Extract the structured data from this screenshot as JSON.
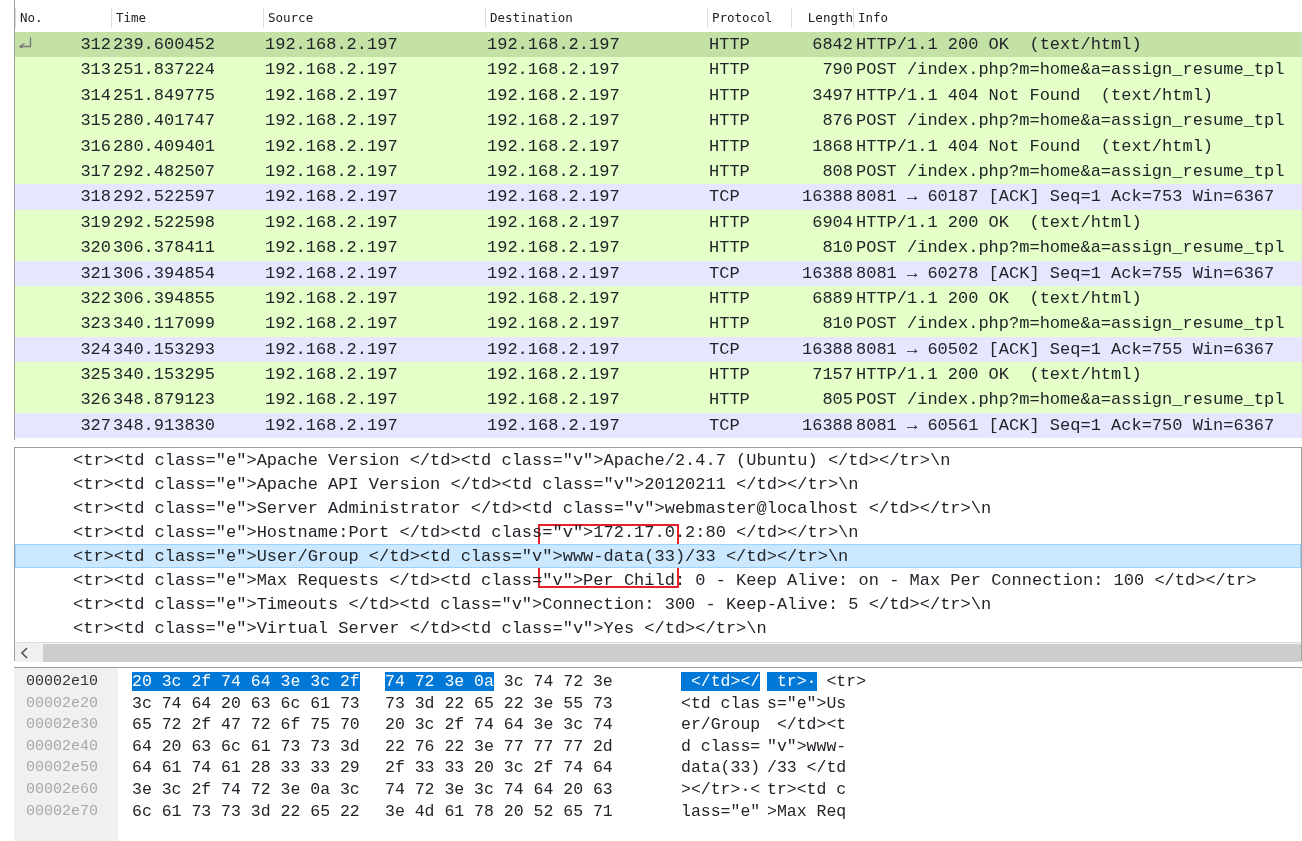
{
  "packet_list": {
    "columns": [
      "No.",
      "Time",
      "Source",
      "Destination",
      "Protocol",
      "Length",
      "Info"
    ],
    "rows": [
      {
        "no": "312",
        "time": "239.600452",
        "source": "192.168.2.197",
        "destination": "192.168.2.197",
        "protocol": "HTTP",
        "length": "6842",
        "info": "HTTP/1.1 200 OK  (text/html)",
        "color": "#e4ffc7",
        "selected": true,
        "related": true
      },
      {
        "no": "313",
        "time": "251.837224",
        "source": "192.168.2.197",
        "destination": "192.168.2.197",
        "protocol": "HTTP",
        "length": "790",
        "info": "POST /index.php?m=home&a=assign_resume_tpl",
        "color": "#e4ffc7",
        "selected": false,
        "related": false
      },
      {
        "no": "314",
        "time": "251.849775",
        "source": "192.168.2.197",
        "destination": "192.168.2.197",
        "protocol": "HTTP",
        "length": "3497",
        "info": "HTTP/1.1 404 Not Found  (text/html)",
        "color": "#e4ffc7",
        "selected": false,
        "related": false
      },
      {
        "no": "315",
        "time": "280.401747",
        "source": "192.168.2.197",
        "destination": "192.168.2.197",
        "protocol": "HTTP",
        "length": "876",
        "info": "POST /index.php?m=home&a=assign_resume_tpl",
        "color": "#e4ffc7",
        "selected": false,
        "related": false
      },
      {
        "no": "316",
        "time": "280.409401",
        "source": "192.168.2.197",
        "destination": "192.168.2.197",
        "protocol": "HTTP",
        "length": "1868",
        "info": "HTTP/1.1 404 Not Found  (text/html)",
        "color": "#e4ffc7",
        "selected": false,
        "related": false
      },
      {
        "no": "317",
        "time": "292.482507",
        "source": "192.168.2.197",
        "destination": "192.168.2.197",
        "protocol": "HTTP",
        "length": "808",
        "info": "POST /index.php?m=home&a=assign_resume_tpl",
        "color": "#e4ffc7",
        "selected": false,
        "related": false
      },
      {
        "no": "318",
        "time": "292.522597",
        "source": "192.168.2.197",
        "destination": "192.168.2.197",
        "protocol": "TCP",
        "length": "16388",
        "info": "8081 → 60187 [ACK] Seq=1 Ack=753 Win=6367",
        "color": "#e7e6ff",
        "selected": false,
        "related": false
      },
      {
        "no": "319",
        "time": "292.522598",
        "source": "192.168.2.197",
        "destination": "192.168.2.197",
        "protocol": "HTTP",
        "length": "6904",
        "info": "HTTP/1.1 200 OK  (text/html)",
        "color": "#e4ffc7",
        "selected": false,
        "related": false
      },
      {
        "no": "320",
        "time": "306.378411",
        "source": "192.168.2.197",
        "destination": "192.168.2.197",
        "protocol": "HTTP",
        "length": "810",
        "info": "POST /index.php?m=home&a=assign_resume_tpl",
        "color": "#e4ffc7",
        "selected": false,
        "related": false
      },
      {
        "no": "321",
        "time": "306.394854",
        "source": "192.168.2.197",
        "destination": "192.168.2.197",
        "protocol": "TCP",
        "length": "16388",
        "info": "8081 → 60278 [ACK] Seq=1 Ack=755 Win=6367",
        "color": "#e7e6ff",
        "selected": false,
        "related": false
      },
      {
        "no": "322",
        "time": "306.394855",
        "source": "192.168.2.197",
        "destination": "192.168.2.197",
        "protocol": "HTTP",
        "length": "6889",
        "info": "HTTP/1.1 200 OK  (text/html)",
        "color": "#e4ffc7",
        "selected": false,
        "related": false
      },
      {
        "no": "323",
        "time": "340.117099",
        "source": "192.168.2.197",
        "destination": "192.168.2.197",
        "protocol": "HTTP",
        "length": "810",
        "info": "POST /index.php?m=home&a=assign_resume_tpl",
        "color": "#e4ffc7",
        "selected": false,
        "related": false
      },
      {
        "no": "324",
        "time": "340.153293",
        "source": "192.168.2.197",
        "destination": "192.168.2.197",
        "protocol": "TCP",
        "length": "16388",
        "info": "8081 → 60502 [ACK] Seq=1 Ack=755 Win=6367",
        "color": "#e7e6ff",
        "selected": false,
        "related": false
      },
      {
        "no": "325",
        "time": "340.153295",
        "source": "192.168.2.197",
        "destination": "192.168.2.197",
        "protocol": "HTTP",
        "length": "7157",
        "info": "HTTP/1.1 200 OK  (text/html)",
        "color": "#e4ffc7",
        "selected": false,
        "related": false
      },
      {
        "no": "326",
        "time": "348.879123",
        "source": "192.168.2.197",
        "destination": "192.168.2.197",
        "protocol": "HTTP",
        "length": "805",
        "info": "POST /index.php?m=home&a=assign_resume_tpl",
        "color": "#e4ffc7",
        "selected": false,
        "related": false
      },
      {
        "no": "327",
        "time": "348.913830",
        "source": "192.168.2.197",
        "destination": "192.168.2.197",
        "protocol": "TCP",
        "length": "16388",
        "info": "8081 → 60561 [ACK] Seq=1 Ack=750 Win=6367",
        "color": "#e7e6ff",
        "selected": false,
        "related": false
      }
    ]
  },
  "details": {
    "highlight_box": true,
    "lines": [
      {
        "text": "<tr><td class=\"e\">Apache Version </td><td class=\"v\">Apache/2.4.7 (Ubuntu) </td></tr>\\n",
        "selected": false
      },
      {
        "text": "<tr><td class=\"e\">Apache API Version </td><td class=\"v\">20120211 </td></tr>\\n",
        "selected": false
      },
      {
        "text": "<tr><td class=\"e\">Server Administrator </td><td class=\"v\">webmaster@localhost </td></tr>\\n",
        "selected": false
      },
      {
        "text": "<tr><td class=\"e\">Hostname:Port </td><td class=\"v\">172.17.0.2:80 </td></tr>\\n",
        "selected": false
      },
      {
        "text": "<tr><td class=\"e\">User/Group </td><td class=\"v\">www-data(33)/33 </td></tr>\\n",
        "selected": true
      },
      {
        "text": "<tr><td class=\"e\">Max Requests </td><td class=\"v\">Per Child: 0 - Keep Alive: on - Max Per Connection: 100 </td></tr>",
        "selected": false
      },
      {
        "text": "<tr><td class=\"e\">Timeouts </td><td class=\"v\">Connection: 300 - Keep-Alive: 5 </td></tr>\\n",
        "selected": false
      },
      {
        "text": "<tr><td class=\"e\">Virtual Server </td><td class=\"v\">Yes </td></tr>\\n",
        "selected": false
      }
    ]
  },
  "hex": {
    "rows": [
      {
        "offset": "00002e10",
        "selected": true,
        "hex": [
          [
            {
              "text": "20 3c 2f 74 64 3e 3c 2f",
              "selected": true
            }
          ],
          [
            {
              "text": "74 72 3e 0a",
              "selected": true
            },
            {
              "text": "3c 74 72 3e",
              "selected": false
            }
          ]
        ],
        "ascii": [
          [
            {
              "text": " </td></",
              "selected": true
            }
          ],
          [
            {
              "text": " tr>·",
              "selected": true
            },
            {
              "text": "<tr>",
              "selected": false
            }
          ]
        ]
      },
      {
        "offset": "00002e20",
        "selected": false,
        "hex": [
          [
            {
              "text": "3c 74 64 20 63 6c 61 73",
              "selected": false
            }
          ],
          [
            {
              "text": "73 3d 22 65 22 3e 55 73",
              "selected": false
            }
          ]
        ],
        "ascii": [
          [
            {
              "text": "<td clas",
              "selected": false
            }
          ],
          [
            {
              "text": "s=\"e\">Us",
              "selected": false
            }
          ]
        ]
      },
      {
        "offset": "00002e30",
        "selected": false,
        "hex": [
          [
            {
              "text": "65 72 2f 47 72 6f 75 70",
              "selected": false
            }
          ],
          [
            {
              "text": "20 3c 2f 74 64 3e 3c 74",
              "selected": false
            }
          ]
        ],
        "ascii": [
          [
            {
              "text": "er/Group",
              "selected": false
            }
          ],
          [
            {
              "text": " </td><t",
              "selected": false
            }
          ]
        ]
      },
      {
        "offset": "00002e40",
        "selected": false,
        "hex": [
          [
            {
              "text": "64 20 63 6c 61 73 73 3d",
              "selected": false
            }
          ],
          [
            {
              "text": "22 76 22 3e 77 77 77 2d",
              "selected": false
            }
          ]
        ],
        "ascii": [
          [
            {
              "text": "d class=",
              "selected": false
            }
          ],
          [
            {
              "text": "\"v\">www-",
              "selected": false
            }
          ]
        ]
      },
      {
        "offset": "00002e50",
        "selected": false,
        "hex": [
          [
            {
              "text": "64 61 74 61 28 33 33 29",
              "selected": false
            }
          ],
          [
            {
              "text": "2f 33 33 20 3c 2f 74 64",
              "selected": false
            }
          ]
        ],
        "ascii": [
          [
            {
              "text": "data(33)",
              "selected": false
            }
          ],
          [
            {
              "text": "/33 </td",
              "selected": false
            }
          ]
        ]
      },
      {
        "offset": "00002e60",
        "selected": false,
        "hex": [
          [
            {
              "text": "3e 3c 2f 74 72 3e 0a 3c",
              "selected": false
            }
          ],
          [
            {
              "text": "74 72 3e 3c 74 64 20 63",
              "selected": false
            }
          ]
        ],
        "ascii": [
          [
            {
              "text": "></tr>·<",
              "selected": false
            }
          ],
          [
            {
              "text": "tr><td c",
              "selected": false
            }
          ]
        ]
      },
      {
        "offset": "00002e70",
        "selected": false,
        "hex": [
          [
            {
              "text": "6c 61 73 73 3d 22 65 22",
              "selected": false
            }
          ],
          [
            {
              "text": "3e 4d 61 78 20 52 65 71",
              "selected": false
            }
          ]
        ],
        "ascii": [
          [
            {
              "text": "lass=\"e\"",
              "selected": false
            }
          ],
          [
            {
              "text": ">Max Req",
              "selected": false
            }
          ]
        ]
      }
    ]
  }
}
